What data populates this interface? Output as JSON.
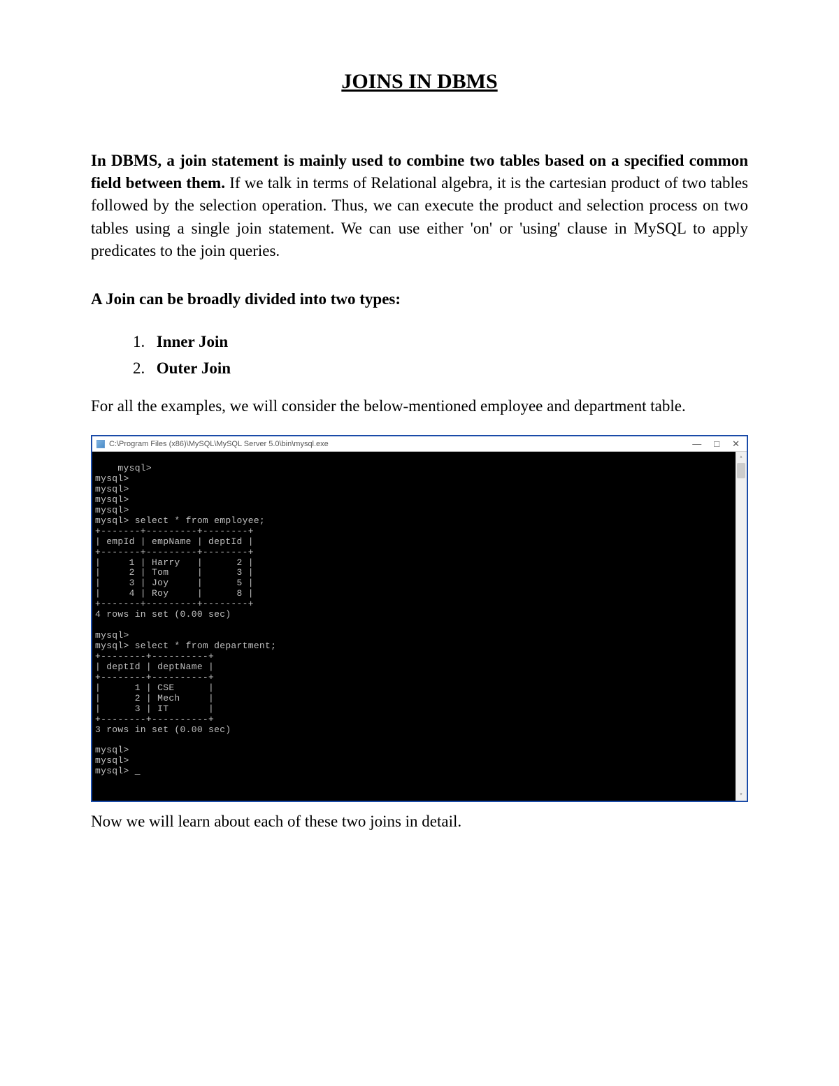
{
  "title": "JOINS IN DBMS",
  "intro": {
    "bold": "In DBMS, a join statement is mainly used to combine two tables based on a specified common field between them.",
    "rest": " If we talk in terms of Relational algebra, it is the cartesian product of two tables followed by the selection operation. Thus, we can execute the product and selection process on two tables using a single join statement. We can use either 'on' or 'using' clause in MySQL to apply predicates to the join queries."
  },
  "subheading": "A Join can be broadly divided into two types:",
  "list": [
    {
      "num": "1.",
      "text": "Inner Join"
    },
    {
      "num": "2.",
      "text": "Outer Join"
    }
  ],
  "body_para": "For all the examples, we will consider the below-mentioned employee and department table.",
  "terminal": {
    "window_title": "C:\\Program Files (x86)\\MySQL\\MySQL Server 5.0\\bin\\mysql.exe",
    "content": "mysql>\nmysql>\nmysql>\nmysql>\nmysql>\nmysql> select * from employee;\n+-------+---------+--------+\n| empId | empName | deptId |\n+-------+---------+--------+\n|     1 | Harry   |      2 |\n|     2 | Tom     |      3 |\n|     3 | Joy     |      5 |\n|     4 | Roy     |      8 |\n+-------+---------+--------+\n4 rows in set (0.00 sec)\n\nmysql>\nmysql> select * from department;\n+--------+----------+\n| deptId | deptName |\n+--------+----------+\n|      1 | CSE      |\n|      2 | Mech     |\n|      3 | IT       |\n+--------+----------+\n3 rows in set (0.00 sec)\n\nmysql>\nmysql>\nmysql> _"
  },
  "closing": "Now we will learn about each of these two joins in detail.",
  "win_controls": {
    "minimize": "—",
    "maximize": "□",
    "close": "✕"
  },
  "scroll_arrows": {
    "up": "▴",
    "down": "▾"
  }
}
